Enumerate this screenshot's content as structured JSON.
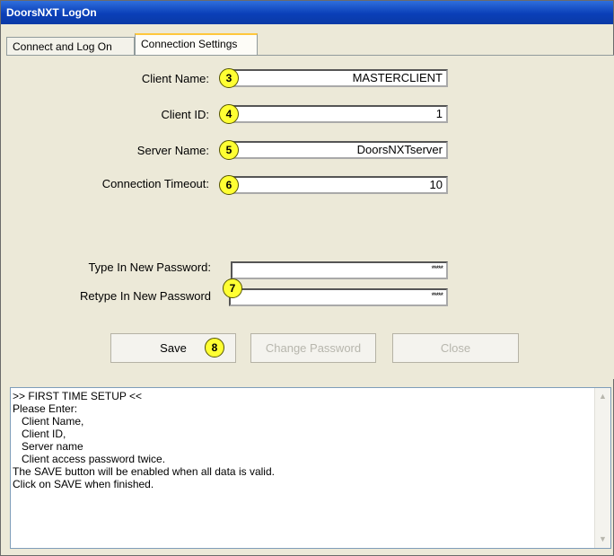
{
  "window": {
    "title": "DoorsNXT LogOn"
  },
  "tabs": [
    {
      "label": "Connect and Log On"
    },
    {
      "label": "Connection Settings"
    }
  ],
  "form": {
    "client_name": {
      "label": "Client Name:",
      "value": "MASTERCLIENT",
      "badge": "3"
    },
    "client_id": {
      "label": "Client ID:",
      "value": "1",
      "badge": "4"
    },
    "server_name": {
      "label": "Server Name:",
      "value": "DoorsNXTserver",
      "badge": "5"
    },
    "timeout": {
      "label": "Connection Timeout:",
      "value": "10",
      "badge": "6"
    },
    "new_password": {
      "label": "Type In New Password:",
      "value": "*****"
    },
    "retype_password": {
      "label": "Retype In New Password",
      "value": "*****"
    },
    "password_badge": "7"
  },
  "buttons": {
    "save": "Save",
    "save_badge": "8",
    "change_password": "Change Password",
    "close": "Close"
  },
  "console": {
    "lines": [
      ">> FIRST TIME SETUP <<",
      "Please Enter:",
      "",
      "   Client Name,",
      "   Client ID,",
      "   Server name",
      "   Client access password twice.",
      "",
      "The SAVE button will be enabled when all data is valid.",
      "Click on SAVE when finished."
    ]
  }
}
